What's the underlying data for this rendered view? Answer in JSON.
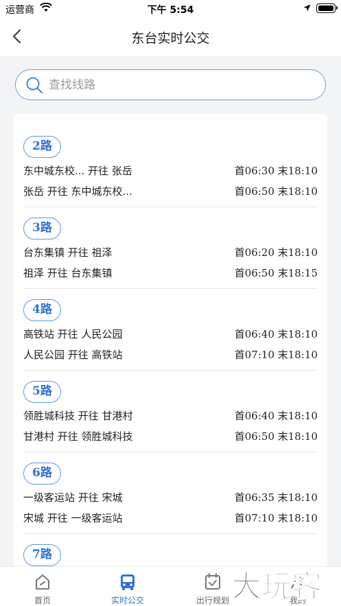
{
  "status_bar": {
    "carrier": "运营商",
    "time": "下午 5:54"
  },
  "header": {
    "title": "东台实时公交",
    "back_icon": "chevron-left-icon"
  },
  "search": {
    "placeholder": "查找线路",
    "value": "",
    "icon": "search-icon"
  },
  "routes": [
    {
      "name": "2路",
      "directions": [
        {
          "label": "东中城东校... 开往 张岳",
          "hours": "首06:30 末18:10"
        },
        {
          "label": "张岳 开往 东中城东校...",
          "hours": "首06:50 末18:10"
        }
      ]
    },
    {
      "name": "3路",
      "directions": [
        {
          "label": "台东集镇 开往 祖泽",
          "hours": "首06:20 末18:10"
        },
        {
          "label": "祖泽 开往 台东集镇",
          "hours": "首06:50 末18:15"
        }
      ]
    },
    {
      "name": "4路",
      "directions": [
        {
          "label": "高铁站 开往 人民公园",
          "hours": "首06:40 末18:10"
        },
        {
          "label": "人民公园 开往 高铁站",
          "hours": "首07:10 末18:10"
        }
      ]
    },
    {
      "name": "5路",
      "directions": [
        {
          "label": "领胜城科技 开往 甘港村",
          "hours": "首06:40 末18:10"
        },
        {
          "label": "甘港村 开往 领胜城科技",
          "hours": "首06:50 末18:10"
        }
      ]
    },
    {
      "name": "6路",
      "directions": [
        {
          "label": "一级客运站 开往 宋城",
          "hours": "首06:35 末18:10"
        },
        {
          "label": "宋城 开往 一级客运站",
          "hours": "首07:10 末18:10"
        }
      ]
    },
    {
      "name": "7路",
      "directions": []
    }
  ],
  "tabbar": {
    "tabs": [
      {
        "label": "首页",
        "icon": "home-icon"
      },
      {
        "label": "实时公交",
        "icon": "bus-icon"
      },
      {
        "label": "出行规划",
        "icon": "calendar-icon"
      },
      {
        "label": "我的",
        "icon": "user-icon"
      }
    ],
    "active_index": 1
  },
  "watermark": "大玩客",
  "colors": {
    "accent": "#2f73d3",
    "accent_border": "#5b97e2",
    "background": "#f3f4f6"
  }
}
